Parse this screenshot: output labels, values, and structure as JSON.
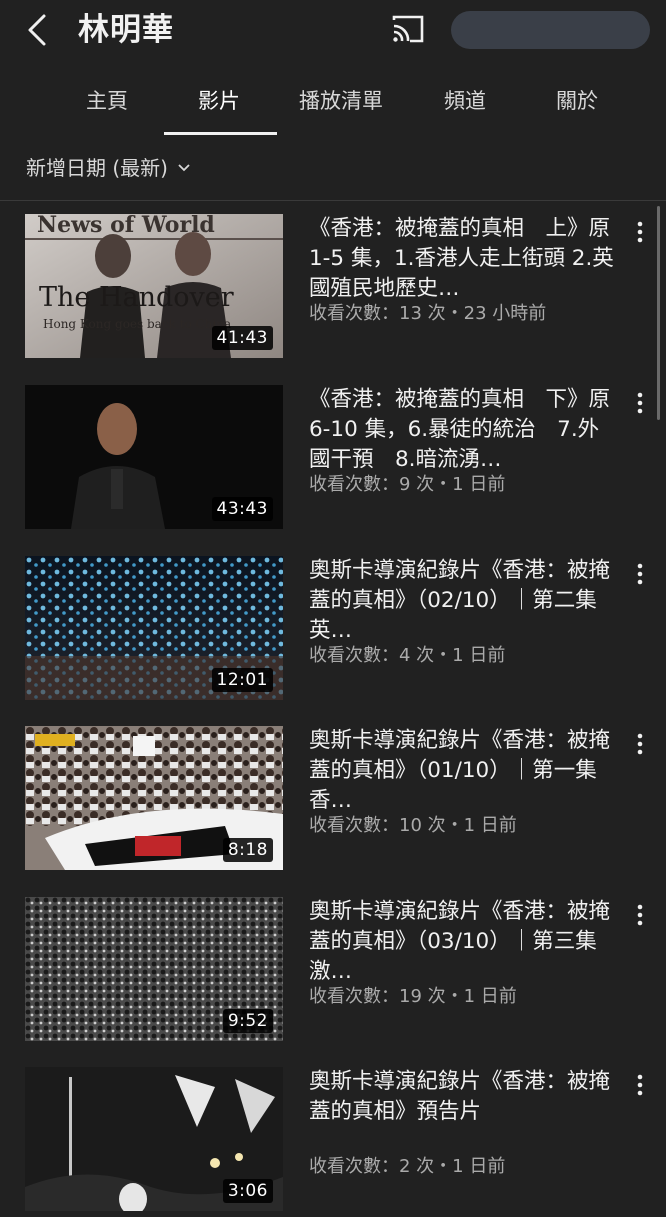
{
  "header": {
    "title": "林明華",
    "back_icon": "chevron-left-icon",
    "cast_icon": "cast-icon"
  },
  "tabs": [
    {
      "label": "主頁",
      "active": false
    },
    {
      "label": "影片",
      "active": true
    },
    {
      "label": "播放清單",
      "active": false
    },
    {
      "label": "頻道",
      "active": false
    },
    {
      "label": "關於",
      "active": false
    }
  ],
  "sort": {
    "label": "新增日期 (最新)"
  },
  "videos": [
    {
      "title": "《香港：被掩蓋的真相　上》原 1-5 集，1.香港人走上街頭 2.英國殖民地歷史…",
      "meta": "收看次數：13 次・23 小時前",
      "duration": "41:43"
    },
    {
      "title": "《香港：被掩蓋的真相　下》原 6-10 集，6.暴徒的統治　7.外國干預　8.暗流湧…",
      "meta": "收看次數：9 次・1 日前",
      "duration": "43:43"
    },
    {
      "title": "奧斯卡導演紀錄片《香港：被掩蓋的真相》（02/10）｜第二集　英…",
      "meta": "收看次數：4 次・1 日前",
      "duration": "12:01"
    },
    {
      "title": "奧斯卡導演紀錄片《香港：被掩蓋的真相》（01/10）｜第一集　香…",
      "meta": "收看次數：10 次・1 日前",
      "duration": "8:18"
    },
    {
      "title": "奧斯卡導演紀錄片《香港：被掩蓋的真相》（03/10）｜第三集　激…",
      "meta": "收看次數：19 次・1 日前",
      "duration": "9:52"
    },
    {
      "title": "奧斯卡導演紀錄片《香港：被掩蓋的真相》預告片",
      "meta": "收看次數：2 次・1 日前",
      "duration": "3:06"
    }
  ],
  "thumbnail_text": {
    "newspaper_masthead": "News of World",
    "headline": "The Handover",
    "subheadline": "Hong Kong goes back to China"
  },
  "colors": {
    "background": "#212121",
    "text": "#f1f1f1",
    "meta": "#aaaaaa",
    "pill": "#3a3f48"
  }
}
